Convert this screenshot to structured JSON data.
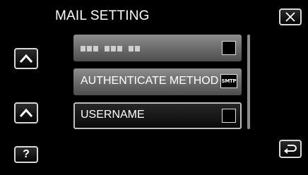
{
  "header": {
    "title": "MAIL SETTING"
  },
  "rows": [
    {
      "label": "",
      "masked_groups": [
        3,
        3,
        2
      ]
    },
    {
      "label": "AUTHENTICATE METHOD",
      "badge": "SMTP"
    },
    {
      "label": "USERNAME"
    }
  ],
  "buttons": {
    "help_label": "?"
  },
  "icons": [
    "close-icon",
    "chevron-up-icon",
    "chevron-up-icon",
    "back-arrow-icon"
  ],
  "colors": {
    "background": "#000000",
    "row_active": "#1a1a1a",
    "row_inactive": "#6e6e6e",
    "text": "#ffffff"
  }
}
